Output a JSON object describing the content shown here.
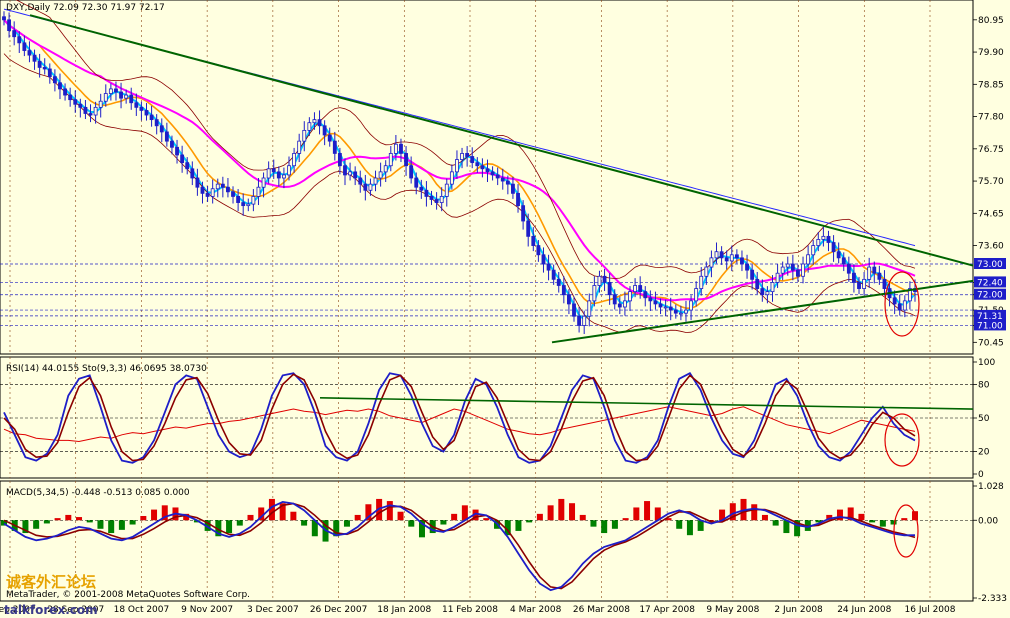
{
  "chart_data": [
    {
      "type": "candlestick",
      "title": "DXY,Daily  72.09 72.30 71.97 72.17",
      "symbol": "DXY",
      "timeframe": "Daily",
      "ohlc_last": {
        "open": 72.09,
        "high": 72.3,
        "low": 71.97,
        "close": 72.17
      },
      "ylim": [
        70.2,
        81.4
      ],
      "y_ticks": [
        "80.95",
        "79.90",
        "78.85",
        "77.80",
        "76.75",
        "75.70",
        "74.65",
        "73.60",
        "72.40",
        "72.00",
        "71.50",
        "71.31",
        "71.00",
        "70.45"
      ],
      "price_tags": [
        {
          "value": "73.00",
          "color": "#1E1EC8"
        },
        {
          "value": "72.40",
          "color": "#1E1EC8"
        },
        {
          "value": "72.00",
          "color": "#1E1EC8"
        },
        {
          "value": "71.31",
          "color": "#1E1EC8"
        },
        {
          "value": "71.00",
          "color": "#1E1EC8"
        }
      ],
      "horizontal_levels": [
        73.0,
        72.4,
        72.0,
        71.5,
        71.31,
        71.0
      ],
      "x_ticks": [
        "5 Sep 2007",
        "28 Sep 2007",
        "18 Oct 2007",
        "9 Nov 2007",
        "3 Dec 2007",
        "26 Dec 2007",
        "18 Jan 2008",
        "11 Feb 2008",
        "4 Mar 2008",
        "26 Mar 2008",
        "17 Apr 2008",
        "9 May 2008",
        "2 Jun 2008",
        "24 Jun 2008",
        "16 Jul 2008"
      ],
      "close_series": [
        80.95,
        80.6,
        80.4,
        80.2,
        79.95,
        79.8,
        79.6,
        79.4,
        79.35,
        79.1,
        78.9,
        78.7,
        78.5,
        78.35,
        78.2,
        78.1,
        77.9,
        77.85,
        78.1,
        78.3,
        78.55,
        78.7,
        78.6,
        78.4,
        78.5,
        78.25,
        78.1,
        78.0,
        77.85,
        77.7,
        77.5,
        77.3,
        77.0,
        76.8,
        76.55,
        76.3,
        76.1,
        75.8,
        75.5,
        75.3,
        75.2,
        75.45,
        75.6,
        75.5,
        75.35,
        75.2,
        75.0,
        74.9,
        74.95,
        75.2,
        75.5,
        75.8,
        76.1,
        76.0,
        75.8,
        75.9,
        76.2,
        76.6,
        77.0,
        77.35,
        77.6,
        77.7,
        77.5,
        77.2,
        77.0,
        76.6,
        76.2,
        75.9,
        76.0,
        75.8,
        75.6,
        75.4,
        75.6,
        75.8,
        76.0,
        76.2,
        76.6,
        76.9,
        76.6,
        76.2,
        75.8,
        75.5,
        75.4,
        75.2,
        75.1,
        75.0,
        75.2,
        75.6,
        76.0,
        76.4,
        76.6,
        76.5,
        76.3,
        76.2,
        76.1,
        76.0,
        75.9,
        75.8,
        75.7,
        75.6,
        75.3,
        74.9,
        74.4,
        73.9,
        73.6,
        73.3,
        73.0,
        72.8,
        72.5,
        72.3,
        72.0,
        71.7,
        71.3,
        71.0,
        71.3,
        71.8,
        72.3,
        72.6,
        72.4,
        72.0,
        71.7,
        71.6,
        71.8,
        72.1,
        72.3,
        72.1,
        71.9,
        71.8,
        71.7,
        71.6,
        71.6,
        71.5,
        71.4,
        71.4,
        71.5,
        71.8,
        72.2,
        72.6,
        72.9,
        73.2,
        73.4,
        73.2,
        73.1,
        73.3,
        73.2,
        73.0,
        72.8,
        72.5,
        72.2,
        72.0,
        72.1,
        72.4,
        72.7,
        72.9,
        73.0,
        72.8,
        72.6,
        73.0,
        73.3,
        73.6,
        73.8,
        73.9,
        73.7,
        73.4,
        73.2,
        73.0,
        72.7,
        72.4,
        72.2,
        72.5,
        72.9,
        72.7,
        72.5,
        72.2,
        71.9,
        71.7,
        71.5,
        71.8,
        72.2,
        72.1
      ],
      "indicators": [
        {
          "name": "SMA fast",
          "color": "#00C8FF"
        },
        {
          "name": "SMA mid",
          "color": "#FF9900"
        },
        {
          "name": "SMA slow",
          "color": "#FF00FF"
        },
        {
          "name": "SMA long",
          "color": "#2828FF"
        },
        {
          "name": "Envelope",
          "color": "#8B0000"
        },
        {
          "name": "Trendlines",
          "color": "#006400"
        }
      ]
    },
    {
      "type": "line",
      "title": "RSI(14) 44.0155 Sto(9,3,3) 46.0695 38.0730",
      "rsi_value": "44.0155",
      "sto_values": [
        "46.0695",
        "38.0730"
      ],
      "ylim": [
        0,
        100
      ],
      "y_ticks": [
        "100",
        "80",
        "50",
        "20",
        "0"
      ],
      "levels": [
        80,
        50,
        20
      ],
      "rsi_series": [
        40,
        36,
        35,
        32,
        31,
        30,
        30,
        29,
        31,
        33,
        32,
        35,
        37,
        36,
        38,
        40,
        42,
        41,
        43,
        45,
        45,
        47,
        48,
        50,
        52,
        54,
        56,
        58,
        56,
        55,
        53,
        55,
        57,
        56,
        58,
        56,
        52,
        50,
        48,
        46,
        50,
        54,
        58,
        56,
        52,
        48,
        44,
        40,
        38,
        36,
        35,
        37,
        40,
        42,
        44,
        46,
        48,
        50,
        52,
        54,
        56,
        58,
        60,
        58,
        56,
        54,
        52,
        54,
        58,
        60,
        56,
        52,
        48,
        44,
        42,
        40,
        38,
        36,
        40,
        44,
        48,
        46,
        44,
        42,
        40,
        38
      ],
      "sto_k_series": [
        55,
        35,
        15,
        12,
        18,
        35,
        70,
        85,
        88,
        60,
        30,
        12,
        10,
        15,
        30,
        55,
        80,
        88,
        85,
        60,
        35,
        20,
        15,
        18,
        40,
        70,
        88,
        90,
        80,
        55,
        25,
        15,
        12,
        20,
        45,
        75,
        90,
        88,
        70,
        45,
        25,
        20,
        35,
        65,
        85,
        80,
        60,
        35,
        15,
        10,
        12,
        25,
        50,
        75,
        88,
        85,
        60,
        30,
        12,
        10,
        15,
        30,
        60,
        85,
        90,
        75,
        50,
        30,
        18,
        15,
        30,
        55,
        80,
        85,
        70,
        45,
        25,
        15,
        12,
        20,
        35,
        50,
        60,
        45,
        35,
        30
      ],
      "sto_d_series": [
        50,
        40,
        22,
        15,
        16,
        28,
        55,
        78,
        86,
        70,
        42,
        20,
        12,
        13,
        25,
        45,
        68,
        84,
        86,
        72,
        48,
        28,
        18,
        17,
        30,
        58,
        80,
        89,
        84,
        65,
        38,
        20,
        14,
        17,
        35,
        62,
        84,
        88,
        78,
        55,
        33,
        22,
        30,
        55,
        78,
        82,
        68,
        45,
        22,
        13,
        12,
        20,
        40,
        65,
        83,
        86,
        70,
        42,
        20,
        12,
        13,
        25,
        50,
        76,
        88,
        80,
        58,
        38,
        22,
        16,
        24,
        45,
        70,
        83,
        76,
        55,
        32,
        20,
        14,
        17,
        28,
        44,
        55,
        50,
        40,
        34
      ]
    },
    {
      "type": "bar",
      "title": "MACD(5,34,5) -0.448 -0.513 0.085 0.000",
      "values_label": [
        "-0.448",
        "-0.513",
        "0.085",
        "0.000"
      ],
      "ylim": [
        -2.333,
        1.028
      ],
      "y_ticks": [
        "1.028",
        "0.00",
        "-2.333"
      ],
      "hist_series": [
        -0.05,
        -0.1,
        -0.12,
        -0.08,
        -0.03,
        0.02,
        0.05,
        0.03,
        -0.02,
        -0.08,
        -0.12,
        -0.09,
        -0.04,
        0.04,
        0.1,
        0.14,
        0.12,
        0.06,
        -0.02,
        -0.1,
        -0.15,
        -0.12,
        -0.05,
        0.05,
        0.12,
        0.2,
        0.16,
        0.08,
        -0.05,
        -0.15,
        -0.2,
        -0.15,
        -0.06,
        0.05,
        0.15,
        0.2,
        0.18,
        0.08,
        -0.06,
        -0.16,
        -0.12,
        -0.04,
        0.06,
        0.14,
        0.1,
        0.02,
        -0.08,
        -0.14,
        -0.1,
        -0.02,
        0.06,
        0.14,
        0.2,
        0.16,
        0.05,
        -0.06,
        -0.12,
        -0.08,
        0.02,
        0.12,
        0.18,
        0.12,
        0.02,
        -0.08,
        -0.14,
        -0.1,
        0.0,
        0.1,
        0.16,
        0.2,
        0.15,
        0.05,
        -0.05,
        -0.12,
        -0.15,
        -0.1,
        -0.02,
        0.05,
        0.1,
        0.12,
        0.06,
        -0.02,
        -0.06,
        -0.04,
        0.02,
        0.085
      ],
      "macd_series": [
        -0.1,
        -0.3,
        -0.5,
        -0.6,
        -0.55,
        -0.45,
        -0.3,
        -0.2,
        -0.25,
        -0.4,
        -0.55,
        -0.6,
        -0.5,
        -0.3,
        -0.1,
        0.1,
        0.2,
        0.15,
        0.0,
        -0.2,
        -0.4,
        -0.5,
        -0.4,
        -0.2,
        0.1,
        0.4,
        0.55,
        0.5,
        0.3,
        0.0,
        -0.3,
        -0.45,
        -0.4,
        -0.2,
        0.1,
        0.35,
        0.45,
        0.4,
        0.2,
        -0.1,
        -0.3,
        -0.35,
        -0.2,
        0.0,
        0.2,
        0.15,
        -0.1,
        -0.5,
        -1.0,
        -1.5,
        -1.9,
        -2.1,
        -2.0,
        -1.7,
        -1.3,
        -1.0,
        -0.8,
        -0.7,
        -0.6,
        -0.4,
        -0.2,
        0.0,
        0.2,
        0.3,
        0.2,
        0.0,
        -0.1,
        0.0,
        0.2,
        0.3,
        0.35,
        0.3,
        0.15,
        0.0,
        -0.15,
        -0.2,
        -0.1,
        0.05,
        0.1,
        0.05,
        -0.1,
        -0.2,
        -0.3,
        -0.4,
        -0.45,
        -0.448
      ],
      "signal_series": [
        0.0,
        -0.15,
        -0.3,
        -0.45,
        -0.5,
        -0.48,
        -0.4,
        -0.3,
        -0.28,
        -0.33,
        -0.45,
        -0.55,
        -0.55,
        -0.42,
        -0.25,
        -0.05,
        0.1,
        0.15,
        0.08,
        -0.08,
        -0.28,
        -0.42,
        -0.45,
        -0.32,
        -0.08,
        0.22,
        0.45,
        0.5,
        0.4,
        0.15,
        -0.15,
        -0.38,
        -0.42,
        -0.3,
        -0.05,
        0.22,
        0.4,
        0.42,
        0.3,
        0.05,
        -0.2,
        -0.32,
        -0.28,
        -0.1,
        0.1,
        0.15,
        0.0,
        -0.3,
        -0.75,
        -1.25,
        -1.7,
        -2.0,
        -2.05,
        -1.85,
        -1.5,
        -1.15,
        -0.9,
        -0.75,
        -0.65,
        -0.5,
        -0.3,
        -0.1,
        0.1,
        0.25,
        0.25,
        0.1,
        -0.05,
        -0.05,
        0.1,
        0.25,
        0.32,
        0.32,
        0.22,
        0.07,
        -0.08,
        -0.18,
        -0.15,
        -0.02,
        0.08,
        0.08,
        -0.03,
        -0.15,
        -0.25,
        -0.35,
        -0.42,
        -0.513
      ]
    }
  ],
  "watermark": {
    "chinese": "诚客外汇论坛",
    "site": "talkforex.com",
    "copyright": "MetaTrader, © 2001-2008 MetaQuotes Software Corp."
  }
}
